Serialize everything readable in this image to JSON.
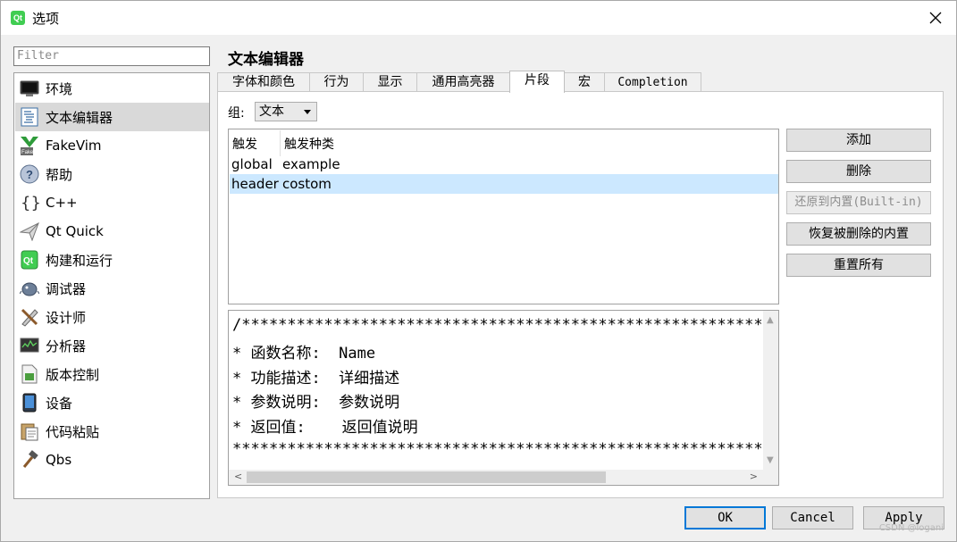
{
  "window": {
    "title": "选项",
    "app_icon_text": "Qt"
  },
  "filter": {
    "placeholder": "Filter"
  },
  "sidebar": {
    "items": [
      {
        "label": "环境",
        "icon": "monitor-icon"
      },
      {
        "label": "文本编辑器",
        "icon": "text-editor-icon"
      },
      {
        "label": "FakeVim",
        "icon": "fakevim-icon"
      },
      {
        "label": "帮助",
        "icon": "help-icon"
      },
      {
        "label": "C++",
        "icon": "braces-icon"
      },
      {
        "label": "Qt Quick",
        "icon": "paper-plane-icon"
      },
      {
        "label": "构建和运行",
        "icon": "build-run-icon"
      },
      {
        "label": "调试器",
        "icon": "debugger-bug-icon"
      },
      {
        "label": "设计师",
        "icon": "designer-tools-icon"
      },
      {
        "label": "分析器",
        "icon": "analyzer-icon"
      },
      {
        "label": "版本控制",
        "icon": "version-control-icon"
      },
      {
        "label": "设备",
        "icon": "device-icon"
      },
      {
        "label": "代码粘贴",
        "icon": "code-paste-icon"
      },
      {
        "label": "Qbs",
        "icon": "hammer-icon"
      }
    ],
    "selected_index": 1
  },
  "page": {
    "title": "文本编辑器"
  },
  "tabs": [
    {
      "label": "字体和颜色"
    },
    {
      "label": "行为"
    },
    {
      "label": "显示"
    },
    {
      "label": "通用高亮器"
    },
    {
      "label": "片段"
    },
    {
      "label": "宏"
    },
    {
      "label": "Completion"
    }
  ],
  "active_tab_index": 4,
  "group": {
    "label": "组:",
    "value": "文本"
  },
  "snippets": {
    "headers": [
      "触发",
      "触发种类"
    ],
    "rows": [
      {
        "trigger": "global",
        "kind": "example"
      },
      {
        "trigger": "header",
        "kind": "costom"
      }
    ],
    "selected_row_index": 1
  },
  "actions": {
    "add": "添加",
    "remove": "删除",
    "restore_builtin": "还原到内置(Built-in)",
    "restore_removed": "恢复被删除的内置",
    "reset_all": "重置所有"
  },
  "editor": {
    "lines": [
      "/***************************************************************",
      "* 函数名称:  Name",
      "* 功能描述:  详细描述",
      "* 参数说明:  参数说明",
      "* 返回值:    返回值说明",
      "****************************************************************"
    ]
  },
  "dialog_buttons": {
    "ok": "OK",
    "cancel": "Cancel",
    "apply": "Apply"
  },
  "watermark": "CSDN @logani",
  "colors": {
    "selection": "#cce8ff",
    "sidebar_selected": "#d9d9d9",
    "default_button_border": "#0078d7",
    "qt_green": "#41cd52"
  }
}
